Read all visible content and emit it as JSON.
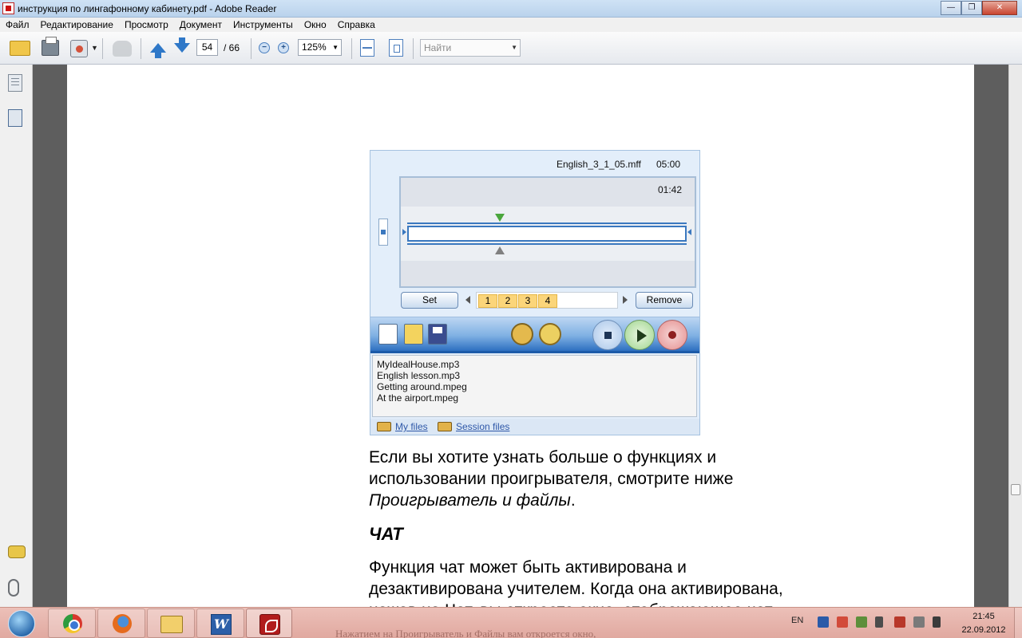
{
  "window": {
    "title": "инструкция по лингафонному кабинету.pdf - Adobe Reader",
    "minimize_label": "—",
    "restore_label": "❐",
    "close_label": "✕"
  },
  "menu": [
    "Файл",
    "Редактирование",
    "Просмотр",
    "Документ",
    "Инструменты",
    "Окно",
    "Справка"
  ],
  "toolbar": {
    "page_current": "54",
    "page_total": "/ 66",
    "zoom_out_label": "−",
    "zoom_in_label": "+",
    "zoom": "125%",
    "find_placeholder": "Найти",
    "caret": "▼"
  },
  "document": {
    "player": {
      "filename": "English_3_1_05.mff",
      "duration": "05:00",
      "position": "01:42",
      "set_label": "Set",
      "remove_label": "Remove",
      "bookmarks": [
        "1",
        "2",
        "3",
        "4"
      ],
      "files": [
        "MyIdealHouse.mp3",
        "English lesson.mp3",
        "Getting around.mpeg",
        "At the airport.mpeg"
      ],
      "my_files_label": "My files",
      "session_files_label": "Session files"
    },
    "para1": [
      "Если вы хотите узнать больше о функциях и",
      "использовании проигрывателя, смотрите ниже"
    ],
    "para1_italic": "Проигрыватель и файлы",
    "para1_end": ".",
    "heading_chat": "ЧАТ",
    "para2": [
      "Функция чат может быть активирована и",
      "дезактивирована учителем. Когда она активирована,",
      "нажав на Чат, вы откроете окно, отображающее чат."
    ]
  },
  "taskbar": {
    "word_label": "W",
    "background_text": "Нажатием на  Проигрыватель и Файлы  вам откроется окно,",
    "language": "EN",
    "time": "21:45",
    "date": "22.09.2012"
  },
  "colors": {
    "accent": "#2f78c8",
    "bookmark": "#fbd57a",
    "player_bar": "#2d6fc0"
  }
}
